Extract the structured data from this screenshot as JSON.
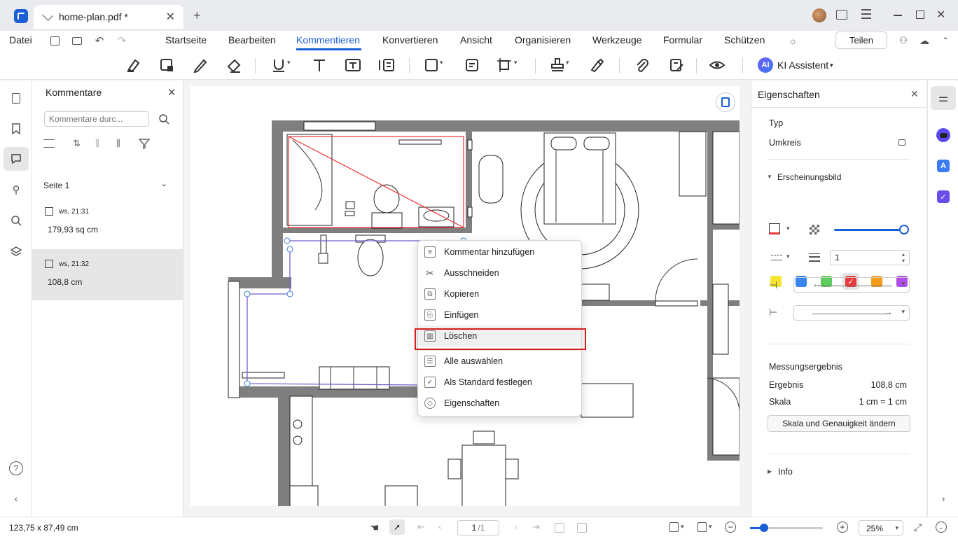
{
  "tab": {
    "title": "home-plan.pdf *"
  },
  "menu": {
    "file": "Datei",
    "items": [
      "Startseite",
      "Bearbeiten",
      "Kommentieren",
      "Konvertieren",
      "Ansicht",
      "Organisieren",
      "Werkzeuge",
      "Formular",
      "Schützen"
    ],
    "active": "Kommentieren",
    "share": "Teilen"
  },
  "toolbar": {
    "ai_label": "KI Assistent",
    "ai_badge": "AI"
  },
  "comments": {
    "title": "Kommentare",
    "search_placeholder": "Kommentare durc...",
    "page_label": "Seite 1",
    "items": [
      {
        "author": "ws,",
        "time": "21:31",
        "value": "179,93 sq cm"
      },
      {
        "author": "ws,",
        "time": "21:32",
        "value": "108,8 cm"
      }
    ]
  },
  "context_menu": {
    "items": [
      "Kommentar hinzufügen",
      "Ausschneiden",
      "Kopieren",
      "Einfügen",
      "Löschen",
      "Alle auswählen",
      "Als Standard festlegen",
      "Eigenschaften"
    ],
    "highlighted": "Löschen"
  },
  "properties": {
    "title": "Eigenschaften",
    "type_label": "Typ",
    "type_value": "Umkreis",
    "appearance_label": "Erscheinungsbild",
    "colors": [
      "#f5e430",
      "#3a86f0",
      "#5ecb5e",
      "#e8393c",
      "#f59c1a",
      "#b04ee8"
    ],
    "selected_color": "#e8393c",
    "line_width": "1",
    "measure_title": "Messungsergebnis",
    "result_label": "Ergebnis",
    "result_value": "108,8 cm",
    "scale_label": "Skala",
    "scale_value": "1 cm = 1 cm",
    "scale_button": "Skala und Genauigkeit ändern",
    "info_label": "Info",
    "opacity": 0.98
  },
  "status": {
    "dimensions": "123,75 x 87,49 cm",
    "page": "1",
    "page_total": "/1",
    "zoom": "25%"
  },
  "accent": "#1a5fd6"
}
